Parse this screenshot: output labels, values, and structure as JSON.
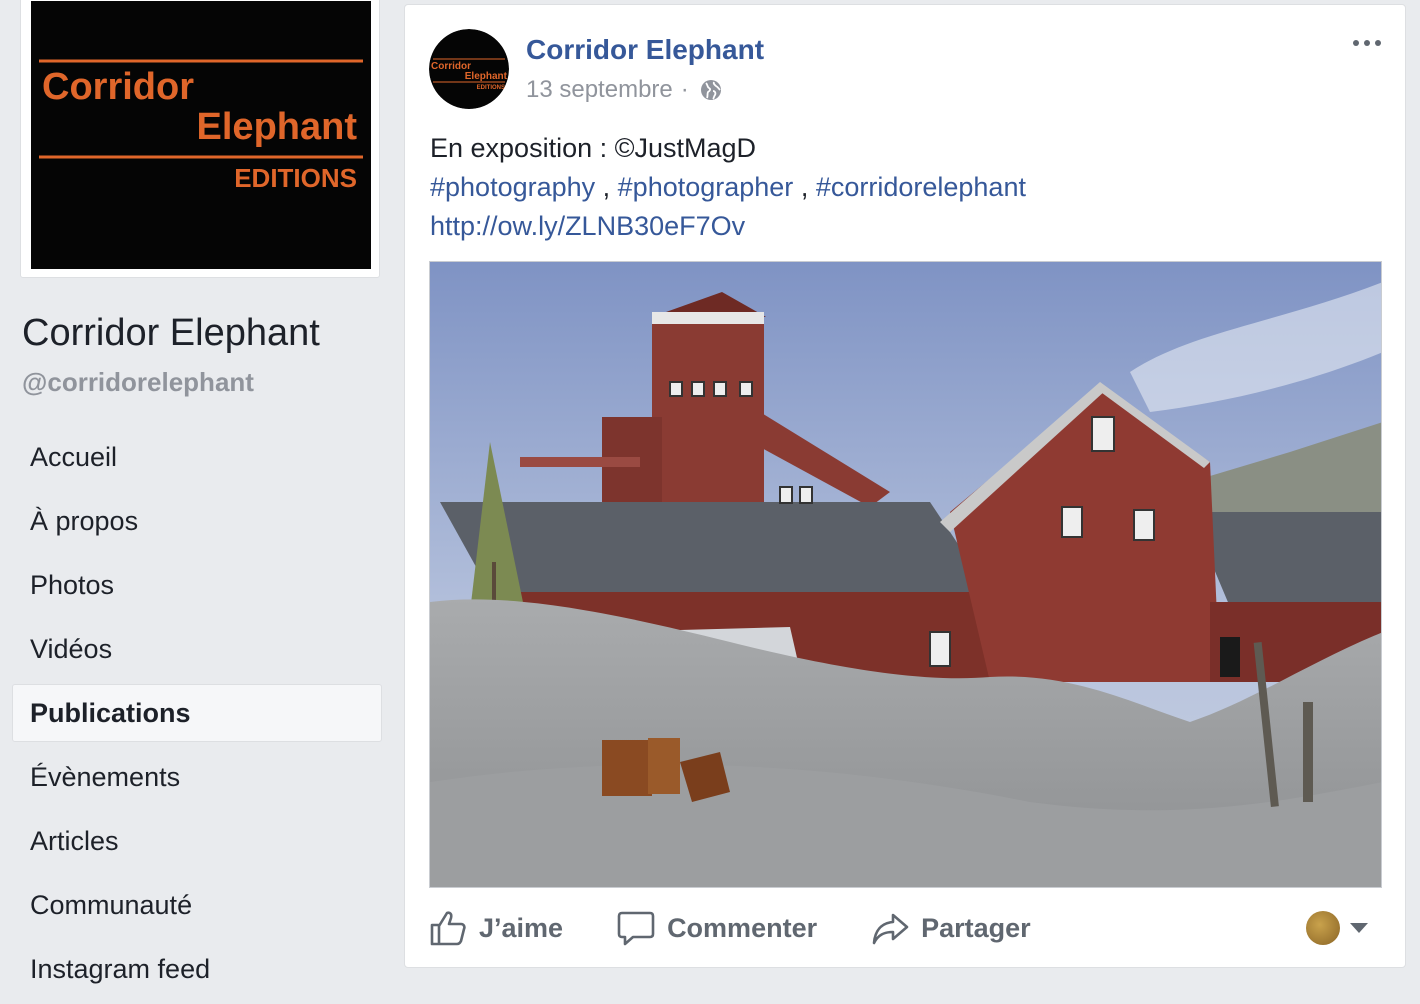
{
  "page": {
    "logo": {
      "line1": "Corridor",
      "line2": "Elephant",
      "line3": "EDITIONS",
      "text_color": "#e0662a",
      "background": "#050505"
    },
    "name": "Corridor Elephant",
    "handle": "@corridorelephant"
  },
  "nav": {
    "items": [
      {
        "label": "Accueil"
      },
      {
        "label": "À propos"
      },
      {
        "label": "Photos"
      },
      {
        "label": "Vidéos"
      },
      {
        "label": "Publications"
      },
      {
        "label": "Évènements"
      },
      {
        "label": "Articles"
      },
      {
        "label": "Communauté"
      },
      {
        "label": "Instagram feed"
      }
    ],
    "active_label": "Publications"
  },
  "post": {
    "author": "Corridor Elephant",
    "date": "13 septembre",
    "separator": "·",
    "privacy_icon": "globe-icon",
    "text_intro": "En exposition : ©JustMagD",
    "hashtags": [
      "#photography",
      "#photographer",
      "#corridorelephant"
    ],
    "hashtag_separator": " , ",
    "url": "http://ow.ly/ZLNB30eF7Ov",
    "image_description_icon": "photo",
    "link_color": "#365899"
  },
  "actions": {
    "like_label": "J’aime",
    "comment_label": "Commenter",
    "share_label": "Partager"
  }
}
